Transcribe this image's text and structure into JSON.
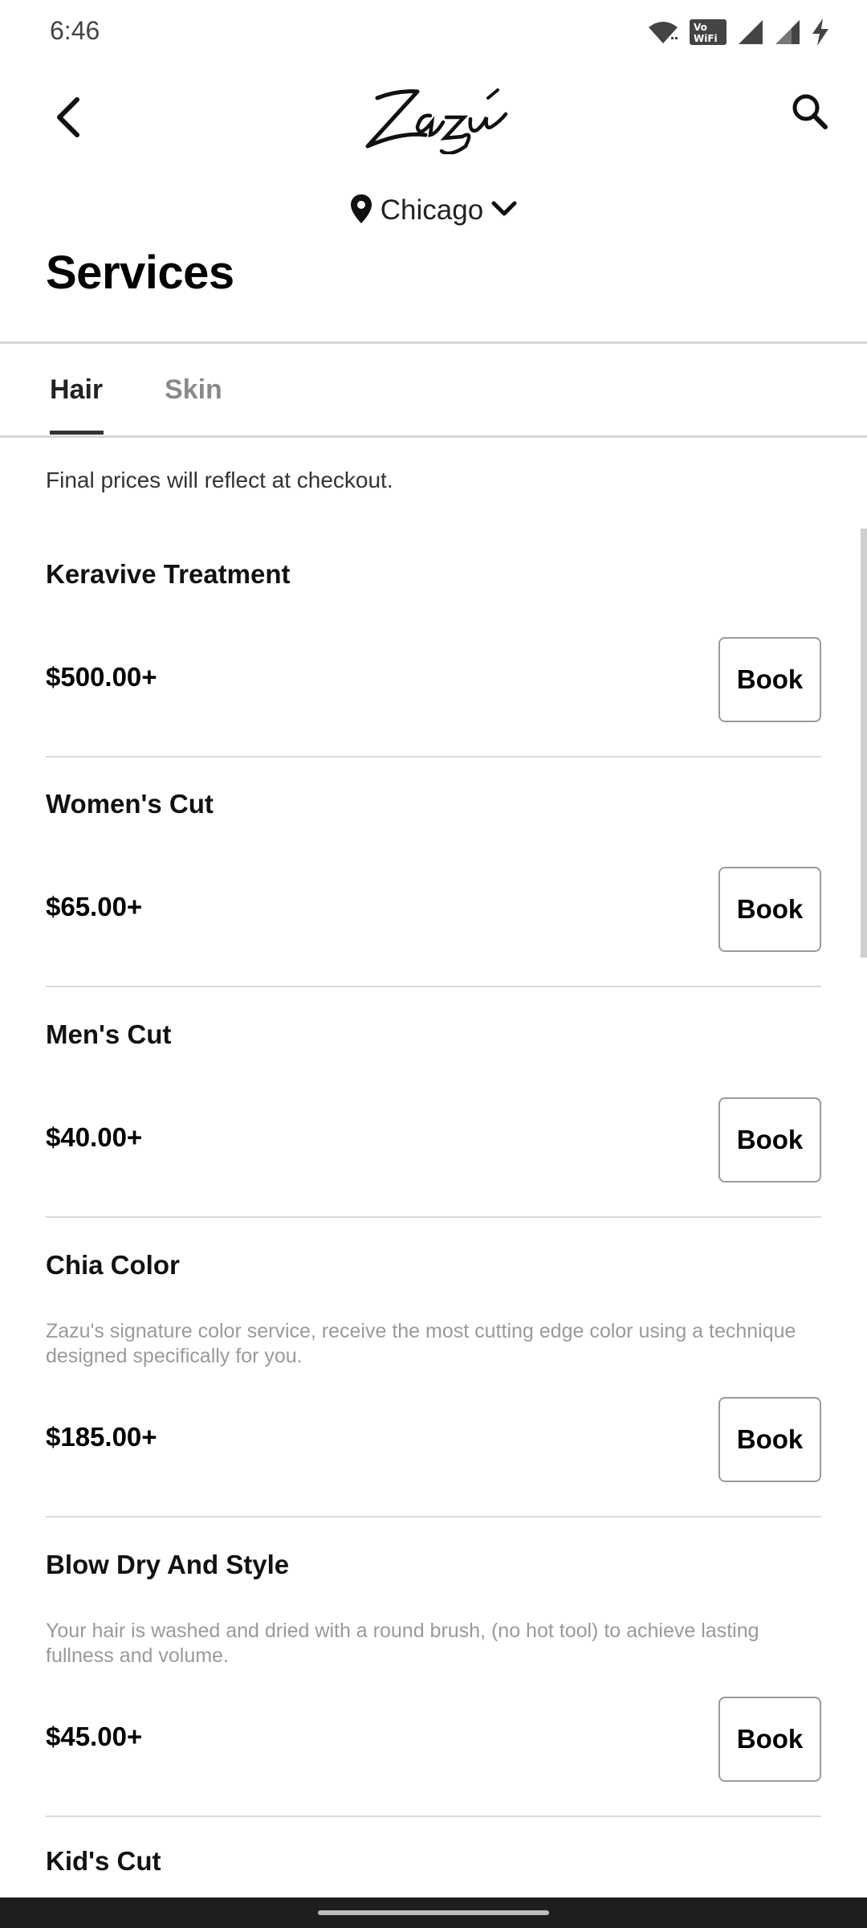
{
  "status_bar": {
    "time": "6:46",
    "icons": [
      "wifi-icon",
      "vowifi-icon",
      "signal-icon",
      "signal-icon",
      "battery-charging-icon"
    ]
  },
  "app_bar": {
    "logo_text": "Zazu",
    "back_icon": "chevron-left-icon",
    "search_icon": "search-icon"
  },
  "location": {
    "label": "Chicago",
    "pin_icon": "location-pin-icon",
    "chevron_icon": "chevron-down-icon"
  },
  "page": {
    "title": "Services"
  },
  "tabs": [
    {
      "label": "Hair",
      "active": true
    },
    {
      "label": "Skin",
      "active": false
    }
  ],
  "note": "Final prices will reflect at checkout.",
  "book_label": "Book",
  "services": [
    {
      "name": "Keravive Treatment",
      "description": "",
      "price": "$500.00+"
    },
    {
      "name": "Women's Cut",
      "description": "",
      "price": "$65.00+"
    },
    {
      "name": "Men's Cut",
      "description": "",
      "price": "$40.00+"
    },
    {
      "name": "Chia Color",
      "description": "Zazu's signature color service,  receive the most cutting edge color using a technique designed specifically for you.",
      "price": "$185.00+"
    },
    {
      "name": "Blow Dry And Style",
      "description": "Your hair is washed and dried with a round brush, (no hot tool) to achieve lasting fullness and volume.",
      "price": "$45.00+"
    },
    {
      "name": "Kid's Cut",
      "description": "",
      "price": ""
    }
  ],
  "colors": {
    "text": "#111111",
    "muted": "#8a8a8a",
    "divider": "#d6d6d6",
    "nav_bar": "#1e1e1e"
  }
}
